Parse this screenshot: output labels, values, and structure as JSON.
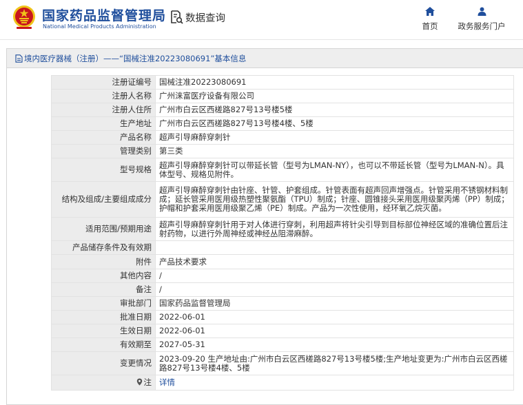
{
  "header": {
    "org_name_cn": "国家药品监督管理局",
    "org_name_en": "National Medical Products Administration",
    "query_label": "数据查询",
    "nav": [
      {
        "label": "首页",
        "icon": "home-icon"
      },
      {
        "label": "政务服务门户",
        "icon": "user-icon"
      }
    ]
  },
  "breadcrumb": "境内医疗器械（注册）——“国械注准20223080691”基本信息",
  "rows": [
    {
      "label": "注册证编号",
      "value": "国械注准20223080691"
    },
    {
      "label": "注册人名称",
      "value": "广州涞富医疗设备有限公司"
    },
    {
      "label": "注册人住所",
      "value": "广州市白云区西槎路827号13号楼5楼"
    },
    {
      "label": "生产地址",
      "value": "广州市白云区西槎路827号13号楼4楼、5楼"
    },
    {
      "label": "产品名称",
      "value": "超声引导麻醉穿刺针"
    },
    {
      "label": "管理类别",
      "value": "第三类"
    },
    {
      "label": "型号规格",
      "value": "超声引导麻醉穿刺针可以带延长管（型号为LMAN-NY），也可以不带延长管（型号为LMAN-N）。具体型号、规格见附件。"
    },
    {
      "label": "结构及组成/主要组成成分",
      "value": "超声引导麻醉穿刺针由针座、针管、护套组成。针管表面有超声回声增强点。针管采用不锈钢材料制成；延长管采用医用级热塑性聚氨酯（TPU）制成；针座、圆锥接头采用医用级聚丙烯（PP）制成；护帽和护套采用医用级聚乙烯（PE）制成。产品为一次性使用，经环氧乙烷灭菌。"
    },
    {
      "label": "适用范围/预期用途",
      "value": "超声引导麻醉穿刺针用于对人体进行穿刺，利用超声将针尖引导到目标部位神经区域的准确位置后注射药物，以进行外周神经或神经丛阻滞麻醉。"
    },
    {
      "label": "产品储存条件及有效期",
      "value": ""
    },
    {
      "label": "附件",
      "value": "产品技术要求"
    },
    {
      "label": "其他内容",
      "value": "/"
    },
    {
      "label": "备注",
      "value": "/"
    },
    {
      "label": "审批部门",
      "value": "国家药品监督管理局"
    },
    {
      "label": "批准日期",
      "value": "2022-06-01"
    },
    {
      "label": "生效日期",
      "value": "2022-06-01"
    },
    {
      "label": "有效期至",
      "value": "2027-05-31"
    },
    {
      "label": "变更情况",
      "value": "2023-09-20 生产地址由:广州市白云区西槎路827号13号楼5楼;生产地址变更为:广州市白云区西槎路827号13号楼4楼、5楼"
    }
  ],
  "note_row": {
    "label": "注",
    "value": "详情"
  },
  "colors": {
    "brand": "#1f4e9c",
    "label_bg": "#ececec",
    "emblem_red": "#c8161d",
    "emblem_gold": "#f0c419"
  }
}
